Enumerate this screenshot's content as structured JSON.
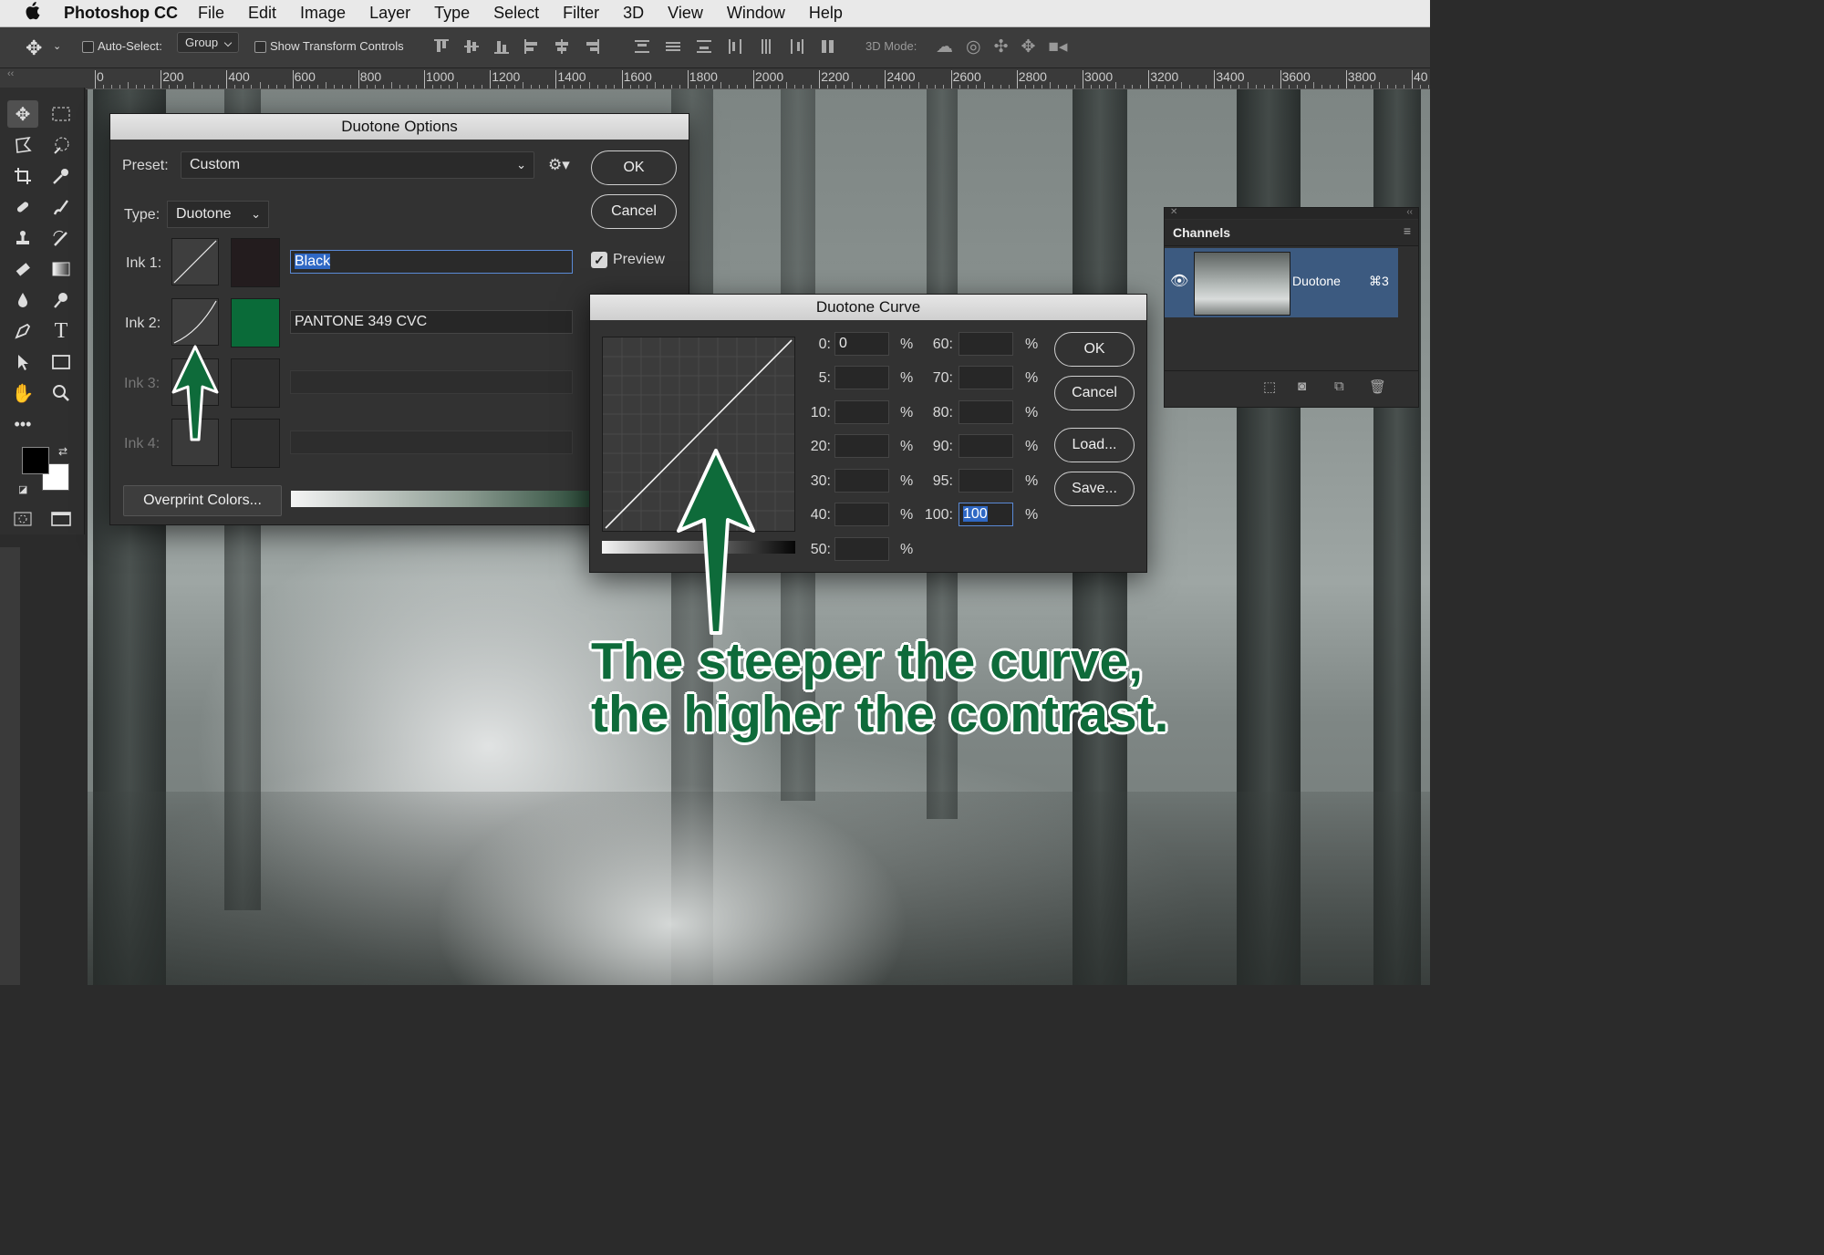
{
  "menubar": {
    "app_name": "Photoshop CC",
    "items": [
      "File",
      "Edit",
      "Image",
      "Layer",
      "Type",
      "Select",
      "Filter",
      "3D",
      "View",
      "Window",
      "Help"
    ]
  },
  "optionsbar": {
    "auto_select_label": "Auto-Select:",
    "auto_select_value": "Group",
    "show_transform_label": "Show Transform Controls",
    "mode_3d_label": "3D Mode:"
  },
  "ruler": {
    "ticks": [
      "0",
      "200",
      "400",
      "600",
      "800",
      "1000",
      "1200",
      "1400",
      "1600",
      "1800",
      "2000",
      "2200",
      "2400",
      "2600",
      "2800",
      "3000",
      "3200",
      "3400",
      "3600",
      "3800",
      "40"
    ]
  },
  "duotone_options": {
    "title": "Duotone Options",
    "preset_label": "Preset:",
    "preset_value": "Custom",
    "type_label": "Type:",
    "type_value": "Duotone",
    "ok_label": "OK",
    "cancel_label": "Cancel",
    "preview_label": "Preview",
    "preview_checked": true,
    "inks": [
      {
        "label": "Ink 1:",
        "name": "Black",
        "color": "#231c1e"
      },
      {
        "label": "Ink 2:",
        "name": "PANTONE 349 CVC",
        "color": "#0a6b39"
      },
      {
        "label": "Ink 3:",
        "name": "",
        "color": "#2e2e2e"
      },
      {
        "label": "Ink 4:",
        "name": "",
        "color": "#2e2e2e"
      }
    ],
    "overprint_label": "Overprint Colors..."
  },
  "duotone_curve": {
    "title": "Duotone Curve",
    "left_points": [
      {
        "label": "0:",
        "value": "0"
      },
      {
        "label": "5:",
        "value": ""
      },
      {
        "label": "10:",
        "value": ""
      },
      {
        "label": "20:",
        "value": ""
      },
      {
        "label": "30:",
        "value": ""
      },
      {
        "label": "40:",
        "value": ""
      },
      {
        "label": "50:",
        "value": ""
      }
    ],
    "right_points": [
      {
        "label": "60:",
        "value": ""
      },
      {
        "label": "70:",
        "value": ""
      },
      {
        "label": "80:",
        "value": ""
      },
      {
        "label": "90:",
        "value": ""
      },
      {
        "label": "95:",
        "value": ""
      },
      {
        "label": "100:",
        "value": "100"
      }
    ],
    "percent": "%",
    "ok_label": "OK",
    "cancel_label": "Cancel",
    "load_label": "Load...",
    "save_label": "Save..."
  },
  "channels_panel": {
    "title": "Channels",
    "channel_name": "Duotone",
    "shortcut": "⌘3"
  },
  "caption": {
    "line1": "The steeper the curve,",
    "line2": "the higher the contrast."
  },
  "colors": {
    "accent_green": "#0e6b3a",
    "selection_blue": "#2f68c4",
    "channel_row_blue": "#3c5a80"
  }
}
